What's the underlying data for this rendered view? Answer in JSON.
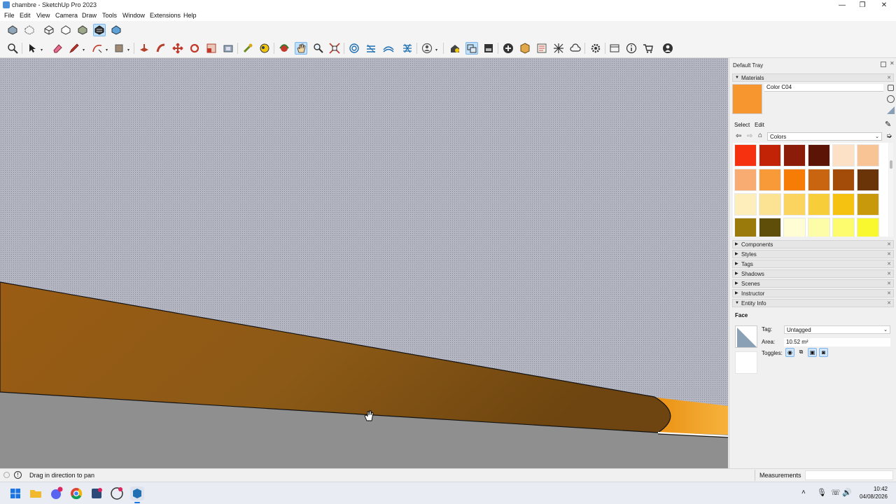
{
  "window": {
    "title": "chambre - SketchUp Pro 2023",
    "minimize": "—",
    "maximize": "❐",
    "close": "✕"
  },
  "menu": [
    "File",
    "Edit",
    "View",
    "Camera",
    "Draw",
    "Tools",
    "Window",
    "Extensions",
    "Help"
  ],
  "tray": {
    "title": "Default Tray",
    "materials": {
      "header": "Materials",
      "material_name": "Color C04",
      "current_color": "#f7962f",
      "tab_select": "Select",
      "tab_edit": "Edit",
      "collection": "Colors",
      "swatches": [
        "#f5310f",
        "#c22306",
        "#8c1c0a",
        "#5c1406",
        "#fde1c7",
        "#f8c495",
        "#f9ac72",
        "#f89a38",
        "#f77c06",
        "#c96410",
        "#a34c0a",
        "#6b3408",
        "#fdeebc",
        "#fbe393",
        "#fad45e",
        "#f8cd3a",
        "#f6c212",
        "#c8990a",
        "#9a7a0a",
        "#5f4d0a",
        "#fefdd4",
        "#fdfca7",
        "#fcfc6e",
        "#f9f82e"
      ]
    },
    "panels": [
      "Components",
      "Styles",
      "Tags",
      "Shadows",
      "Scenes",
      "Instructor",
      "Entity Info"
    ],
    "entity_info": {
      "type": "Face",
      "tag_label": "Tag:",
      "tag_value": "Untagged",
      "area_label": "Area:",
      "area_value": "10.52 m²",
      "toggles_label": "Toggles:"
    }
  },
  "status": {
    "message": "Drag in direction to pan",
    "measurements_label": "Measurements"
  },
  "taskbar": {
    "time": "10:42",
    "date": "04/08/2026"
  },
  "icons": {
    "toolbar1": [
      "shape-style-xray-icon",
      "back-edges-icon",
      "wireframe-icon",
      "hidden-line-icon",
      "shaded-icon",
      "shaded-textures-icon",
      "monochrome-icon"
    ],
    "toolbar2": [
      "zoom-extents-icon",
      "select-icon",
      "eraser-icon",
      "pencil-line-icon",
      "arc-icon",
      "rectangle-icon",
      "push-pull-icon",
      "follow-me-icon",
      "move-icon",
      "rotate-icon",
      "scale-icon",
      "offset-icon",
      "tape-measure-icon",
      "paint-bucket-icon",
      "orbit-icon",
      "pan-icon",
      "zoom-icon",
      "zoom-window-icon",
      "sandbox-smoove-icon",
      "sandbox-stamp-icon",
      "sandbox-drape-icon",
      "sandbox-add-detail-icon",
      "account-icon",
      "warehouse-icon",
      "components-icon",
      "layers-icon",
      "add-icon",
      "extension-icon",
      "section-icon",
      "texture-icon",
      "cloud-icon",
      "settings-icon",
      "scenes-icon",
      "info-icon",
      "cart-icon",
      "profile-icon"
    ]
  }
}
